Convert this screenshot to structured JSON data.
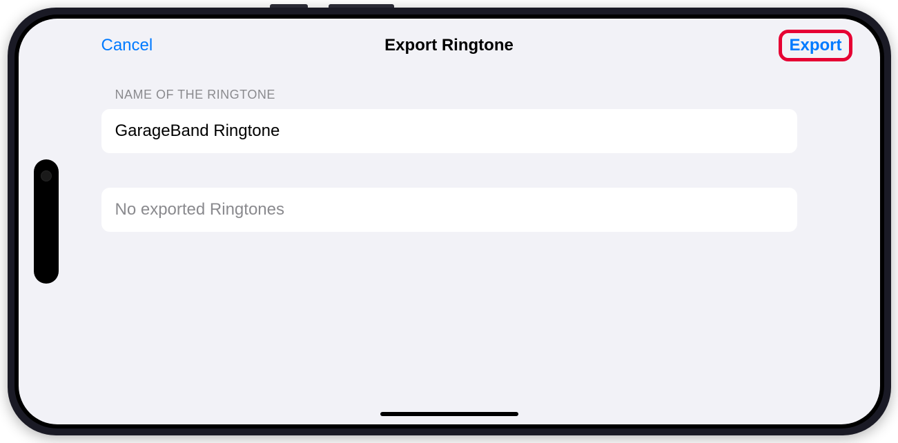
{
  "navbar": {
    "cancel_label": "Cancel",
    "title": "Export Ringtone",
    "export_label": "Export"
  },
  "section": {
    "header": "NAME OF THE RINGTONE",
    "ringtone_name": "GarageBand Ringtone"
  },
  "list": {
    "empty_message": "No exported Ringtones"
  },
  "colors": {
    "accent": "#007aff",
    "highlight": "#e60033",
    "background": "#f2f2f7"
  }
}
